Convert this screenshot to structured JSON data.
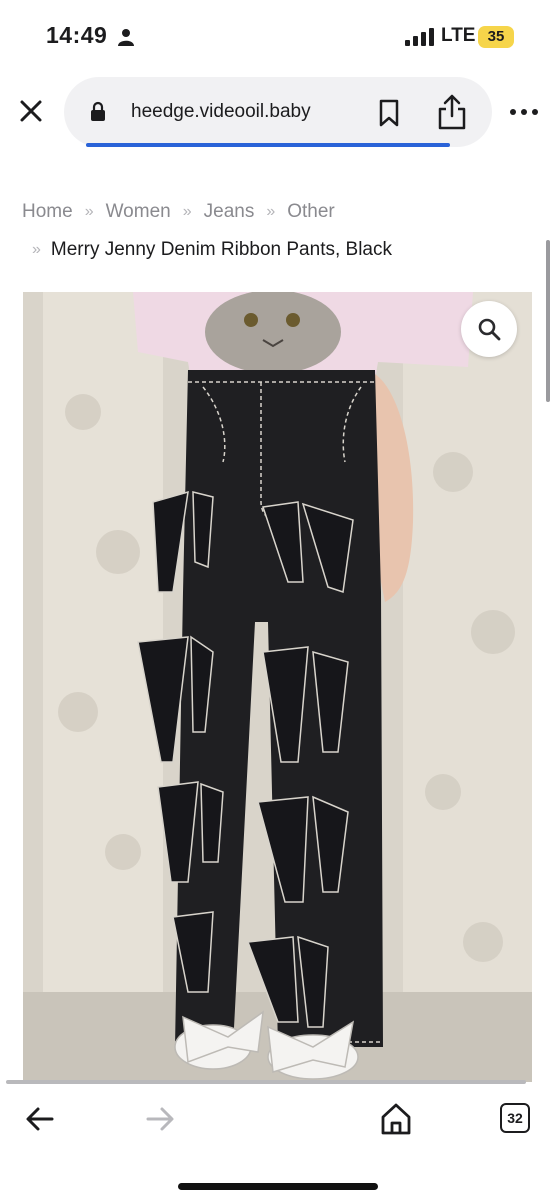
{
  "status_bar": {
    "time": "14:49",
    "network": "LTE",
    "battery": "35",
    "icons": [
      "person-icon",
      "signal-bars-icon"
    ]
  },
  "browser": {
    "url": "heedge.videooil.baby",
    "icons": [
      "close-icon",
      "lock-icon",
      "bookmark-icon",
      "share-icon",
      "more-icon"
    ],
    "tab_count": "32",
    "accent_color": "#2a63d8"
  },
  "breadcrumb": {
    "items": [
      "Home",
      "Women",
      "Jeans",
      "Other"
    ],
    "current": "Merry Jenny Denim Ribbon Pants, Black",
    "separator": "»"
  },
  "product": {
    "zoom_icon": "search-icon"
  },
  "toolbar": {
    "icons": [
      "back-arrow-icon",
      "forward-arrow-icon",
      "home-icon",
      "tabs-icon"
    ]
  }
}
